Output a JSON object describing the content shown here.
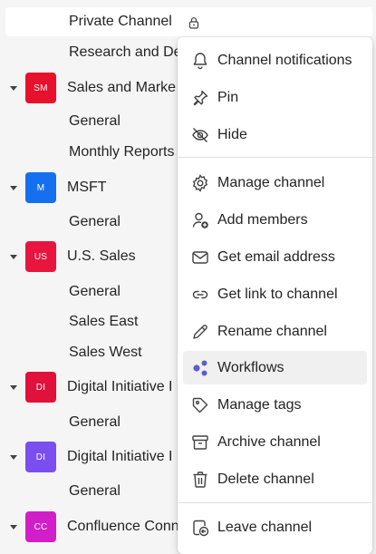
{
  "sidebar": {
    "private_channel": {
      "label": "Private Channel",
      "icon": "lock-icon"
    },
    "research_channel": {
      "label": "Research and De"
    },
    "teams": [
      {
        "avatar": "SM",
        "color": "#e8112d",
        "name": "Sales and Marke",
        "channels": [
          "General",
          "Monthly Reports"
        ]
      },
      {
        "avatar": "M",
        "color": "#1570ef",
        "name": "MSFT",
        "channels": [
          "General"
        ]
      },
      {
        "avatar": "US",
        "color": "#e8153f",
        "name": "U.S. Sales",
        "channels": [
          "General",
          "Sales East",
          "Sales West"
        ]
      },
      {
        "avatar": "DI",
        "color": "#e0113a",
        "name": "Digital Initiative I",
        "channels": [
          "General"
        ]
      },
      {
        "avatar": "DI",
        "color": "#7b4ef0",
        "name": "Digital Initiative I",
        "channels": [
          "General"
        ]
      },
      {
        "avatar": "CC",
        "color": "#d21ec8",
        "name": "Confluence Conn",
        "channels": []
      }
    ]
  },
  "context_menu": {
    "items": [
      {
        "label": "Channel notifications",
        "icon": "bell-icon"
      },
      {
        "label": "Pin",
        "icon": "pin-icon"
      },
      {
        "label": "Hide",
        "icon": "eye-off-icon"
      },
      {
        "label": "Manage channel",
        "icon": "gear-icon"
      },
      {
        "label": "Add members",
        "icon": "person-add-icon"
      },
      {
        "label": "Get email address",
        "icon": "mail-icon"
      },
      {
        "label": "Get link to channel",
        "icon": "link-icon"
      },
      {
        "label": "Rename channel",
        "icon": "pencil-icon"
      },
      {
        "label": "Workflows",
        "icon": "workflows-icon",
        "highlighted": true
      },
      {
        "label": "Manage tags",
        "icon": "tag-icon"
      },
      {
        "label": "Archive channel",
        "icon": "archive-icon"
      },
      {
        "label": "Delete channel",
        "icon": "trash-icon"
      },
      {
        "label": "Leave channel",
        "icon": "leave-icon"
      }
    ],
    "accent_color": "#5b5fc7"
  }
}
